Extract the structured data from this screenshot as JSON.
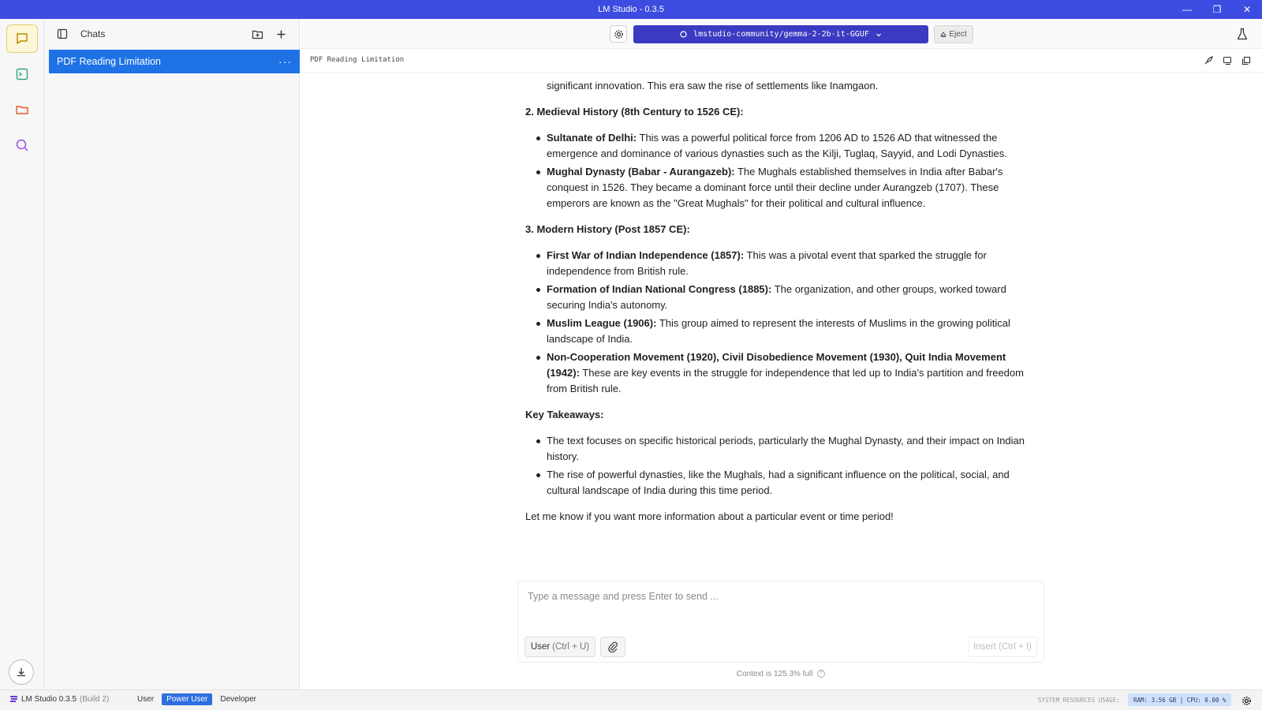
{
  "window": {
    "title": "LM Studio - 0.3.5"
  },
  "chats_panel": {
    "title": "Chats",
    "items": [
      {
        "label": "PDF Reading Limitation",
        "menu": "···"
      }
    ]
  },
  "topbar": {
    "model": "lmstudio-community/gemma-2-2b-it-GGUF",
    "eject": "Eject"
  },
  "chat": {
    "breadcrumb": "PDF Reading Limitation",
    "message": {
      "lead": "significant innovation. This era saw the rise of settlements like Inamgaon.",
      "sections": [
        {
          "heading": "2. Medieval History (8th Century to 1526 CE):",
          "bullets": [
            {
              "bold": "Sultanate of Delhi:",
              "text": " This was a powerful political force from 1206 AD to 1526 AD that witnessed the emergence and dominance of various dynasties such as the Kilji, Tuglaq, Sayyid, and Lodi Dynasties."
            },
            {
              "bold": "Mughal Dynasty (Babar - Aurangazeb):",
              "text": " The Mughals established themselves in India after Babar's conquest in 1526. They became a dominant force until their decline under Aurangzeb (1707). These emperors are known as the \"Great Mughals\" for their political and cultural influence."
            }
          ]
        },
        {
          "heading": "3. Modern History (Post 1857 CE):",
          "bullets": [
            {
              "bold": "First War of Indian Independence (1857):",
              "text": " This was a pivotal event that sparked the struggle for independence from British rule."
            },
            {
              "bold": "Formation of Indian National Congress (1885):",
              "text": " The organization, and other groups, worked toward securing India's autonomy."
            },
            {
              "bold": "Muslim League (1906):",
              "text": " This group aimed to represent the interests of Muslims in the growing political landscape of India."
            },
            {
              "bold": "Non-Cooperation Movement (1920), Civil Disobedience Movement (1930), Quit India Movement (1942):",
              "text": " These are key events in the struggle for independence that led up to India's partition and freedom from British rule."
            }
          ]
        },
        {
          "heading": "Key Takeaways:",
          "bullets": [
            {
              "bold": "",
              "text": "The text focuses on specific historical periods, particularly the Mughal Dynasty, and their impact on Indian history."
            },
            {
              "bold": "",
              "text": "The rise of powerful dynasties, like the Mughals, had a significant influence on the political, social, and cultural landscape of India during this time period."
            }
          ]
        }
      ],
      "closing": "Let me know if you want more information about a particular event or time period!"
    }
  },
  "input": {
    "placeholder": "Type a message and press Enter to send ...",
    "role": "User",
    "role_hint": "(Ctrl + U)",
    "insert": "Insert (Ctrl + I)",
    "context": "Context is 125.3% full"
  },
  "statusbar": {
    "app": "LM Studio 0.3.5",
    "build": "(Build 2)",
    "modes": [
      "User",
      "Power User",
      "Developer"
    ],
    "active_mode": "Power User",
    "sys_label": "SYSTEM RESOURCES USAGE:",
    "usage": "RAM: 3.56 GB | CPU: 0.00 %"
  },
  "colors": {
    "titlebar": "#3c4ce0",
    "accent": "#1e72e6",
    "model_select": "#3a3ac2",
    "chat_rail_active": "#fdf6d8"
  },
  "icons": [
    "chat-icon",
    "terminal-icon",
    "folder-icon",
    "search-icon",
    "download-icon",
    "sidebar-toggle-icon",
    "new-folder-icon",
    "plus-icon",
    "gear-icon",
    "chevron-down-icon",
    "eject-icon",
    "flask-icon",
    "rocket-icon",
    "copy-icon",
    "duplicate-icon",
    "paperclip-icon"
  ]
}
